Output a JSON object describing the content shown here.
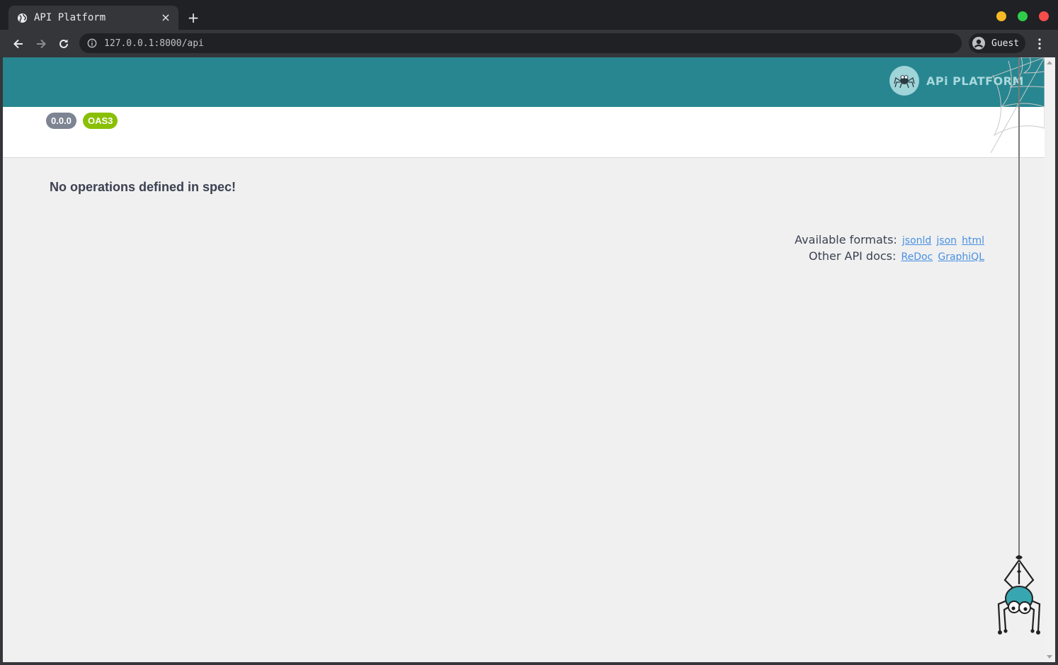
{
  "browser": {
    "tab": {
      "title": "API Platform",
      "close": "×"
    },
    "new_tab": "+",
    "address": "127.0.0.1:8000/api",
    "profile": "Guest"
  },
  "colors": {
    "header": "#288690",
    "version_badge": "#7d8492",
    "oas_badge": "#89bf04",
    "link": "#4990e2"
  },
  "page": {
    "logo_text": "APi PLATFORM",
    "version_badge": "0.0.0",
    "oas_badge": "OAS3",
    "no_ops": "No operations defined in spec!",
    "formats_label": "Available formats:",
    "formats": [
      "jsonld",
      "json",
      "html"
    ],
    "docs_label": "Other API docs:",
    "docs": [
      "ReDoc",
      "GraphiQL"
    ]
  },
  "icons": {
    "favicon": "globe-icon",
    "back": "arrow-left-icon",
    "forward": "arrow-right-icon",
    "reload": "reload-icon",
    "info": "info-icon",
    "profile": "account-icon",
    "menu": "kebab-menu-icon"
  }
}
